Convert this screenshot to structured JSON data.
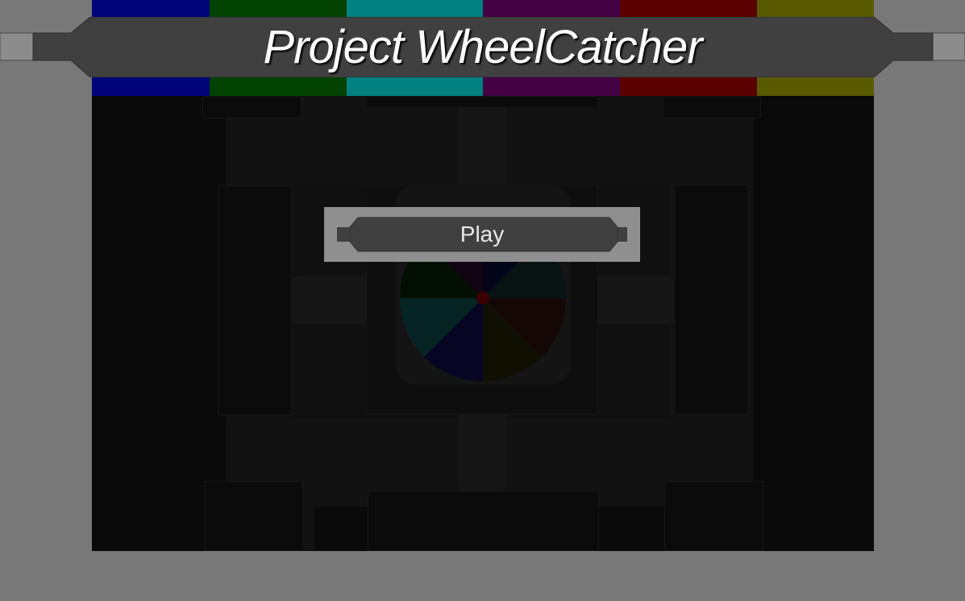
{
  "title": "Project WheelCatcher",
  "menu": {
    "play_label": "Play"
  },
  "stripes": [
    {
      "name": "blue",
      "color": "#010378"
    },
    {
      "name": "green",
      "color": "#014201"
    },
    {
      "name": "cyan",
      "color": "#018080"
    },
    {
      "name": "purple",
      "color": "#430143"
    },
    {
      "name": "red",
      "color": "#5b0000"
    },
    {
      "name": "yellow",
      "color": "#5a5a00"
    }
  ],
  "wheel_segments": [
    {
      "color": "#050519"
    },
    {
      "color": "#081414"
    },
    {
      "color": "#160707"
    },
    {
      "color": "#101002"
    },
    {
      "color": "#060624"
    },
    {
      "color": "#072424"
    },
    {
      "color": "#030f03"
    },
    {
      "color": "#120312"
    }
  ],
  "wheel_hub_color": "#3a0000"
}
